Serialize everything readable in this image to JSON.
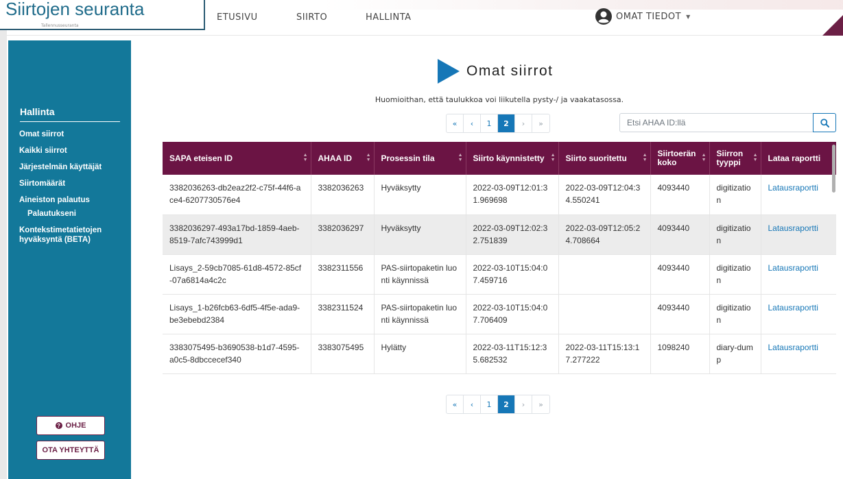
{
  "app": {
    "title": "Siirtojen seuranta",
    "subtitle": "Tallennusseuranta"
  },
  "nav": {
    "home": "ETUSIVU",
    "transfer": "SIIRTO",
    "admin": "HALLINTA",
    "profile": "OMAT TIEDOT"
  },
  "sidebar": {
    "heading": "Hallinta",
    "items": [
      {
        "label": "Omat siirrot"
      },
      {
        "label": "Kaikki siirrot"
      },
      {
        "label": "Järjestelmän käyttäjät"
      },
      {
        "label": "Siirtomäärät"
      },
      {
        "label": "Aineiston palautus"
      },
      {
        "label": "Palautukseni",
        "sub": true
      },
      {
        "label": "Kontekstimetatietojen hyväksyntä (BETA)"
      }
    ],
    "help_button": "OHJE",
    "contact_button": "OTA YHTEYTTÄ"
  },
  "page": {
    "title": "Omat siirrot",
    "hint": "Huomioithan, että taulukkoa voi liikutella pysty-/ ja vaakatasossa."
  },
  "pagination": {
    "first": "«",
    "prev": "‹",
    "pages": [
      "1",
      "2"
    ],
    "current": "2",
    "next": "›",
    "last": "»"
  },
  "search": {
    "placeholder": "Etsi AHAA ID:llä",
    "value": ""
  },
  "table": {
    "columns": [
      "SAPA eteisen ID",
      "AHAA ID",
      "Prosessin tila",
      "Siirto käynnistetty",
      "Siirto suoritettu",
      "Siirtoerän koko",
      "Siirron tyyppi",
      "Lataa raportti"
    ],
    "rows": [
      [
        "3382036263-db2eaz2f2-c75f-44f6-ace4-6207730576e4",
        "3382036263",
        "Hyväksytty",
        "2022-03-09T12:01:31.969698",
        "2022-03-09T12:04:34.550241",
        "4093440",
        "digitization",
        "Latausraportti"
      ],
      [
        "3382036297-493a17bd-1859-4aeb-8519-7afc743999d1",
        "3382036297",
        "Hyväksytty",
        "2022-03-09T12:02:32.751839",
        "2022-03-09T12:05:24.708664",
        "4093440",
        "digitization",
        "Latausraportti"
      ],
      [
        "Lisays_2-59cb7085-61d8-4572-85cf-07a6814a4c2c",
        "3382311556",
        "PAS-siirtopaketin luonti käynnissä",
        "2022-03-10T15:04:07.459716",
        "",
        "4093440",
        "digitization",
        "Latausraportti"
      ],
      [
        "Lisays_1-b26fcb63-6df5-4f5e-ada9-be3ebebd2384",
        "3382311524",
        "PAS-siirtopaketin luonti käynnissä",
        "2022-03-10T15:04:07.706409",
        "",
        "4093440",
        "digitization",
        "Latausraportti"
      ],
      [
        "3383075495-b3690538-b1d7-4595-a0c5-8dbccecef340",
        "3383075495",
        "Hylätty",
        "2022-03-11T15:12:35.682532",
        "2022-03-11T15:13:17.277222",
        "1098240",
        "diary-dump",
        "Latausraportti"
      ]
    ]
  },
  "colors": {
    "primary": "#1677b7",
    "header_bg": "#6b1444",
    "sidebar_bg": "#13789a"
  }
}
